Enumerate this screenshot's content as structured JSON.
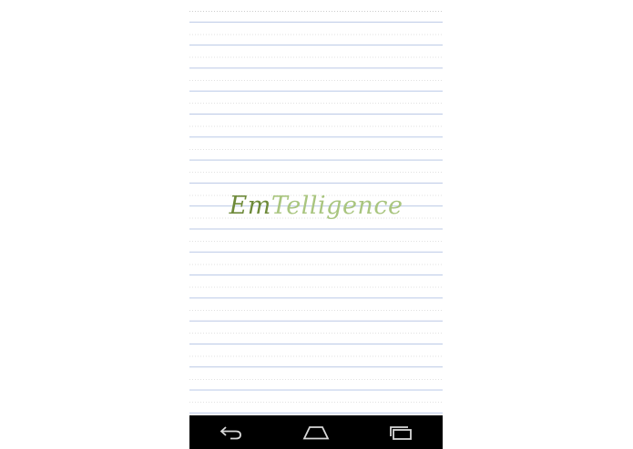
{
  "app": {
    "logo_part_a": "Em",
    "logo_part_b": "Telligence"
  },
  "colors": {
    "logo_dark": "#6e8a3a",
    "logo_light": "#a9c57f",
    "rule_line": "#b9c8e6",
    "navbar": "#000000"
  },
  "navbar": {
    "buttons": [
      {
        "icon": "back-icon"
      },
      {
        "icon": "home-icon"
      },
      {
        "icon": "recent-apps-icon"
      }
    ]
  }
}
